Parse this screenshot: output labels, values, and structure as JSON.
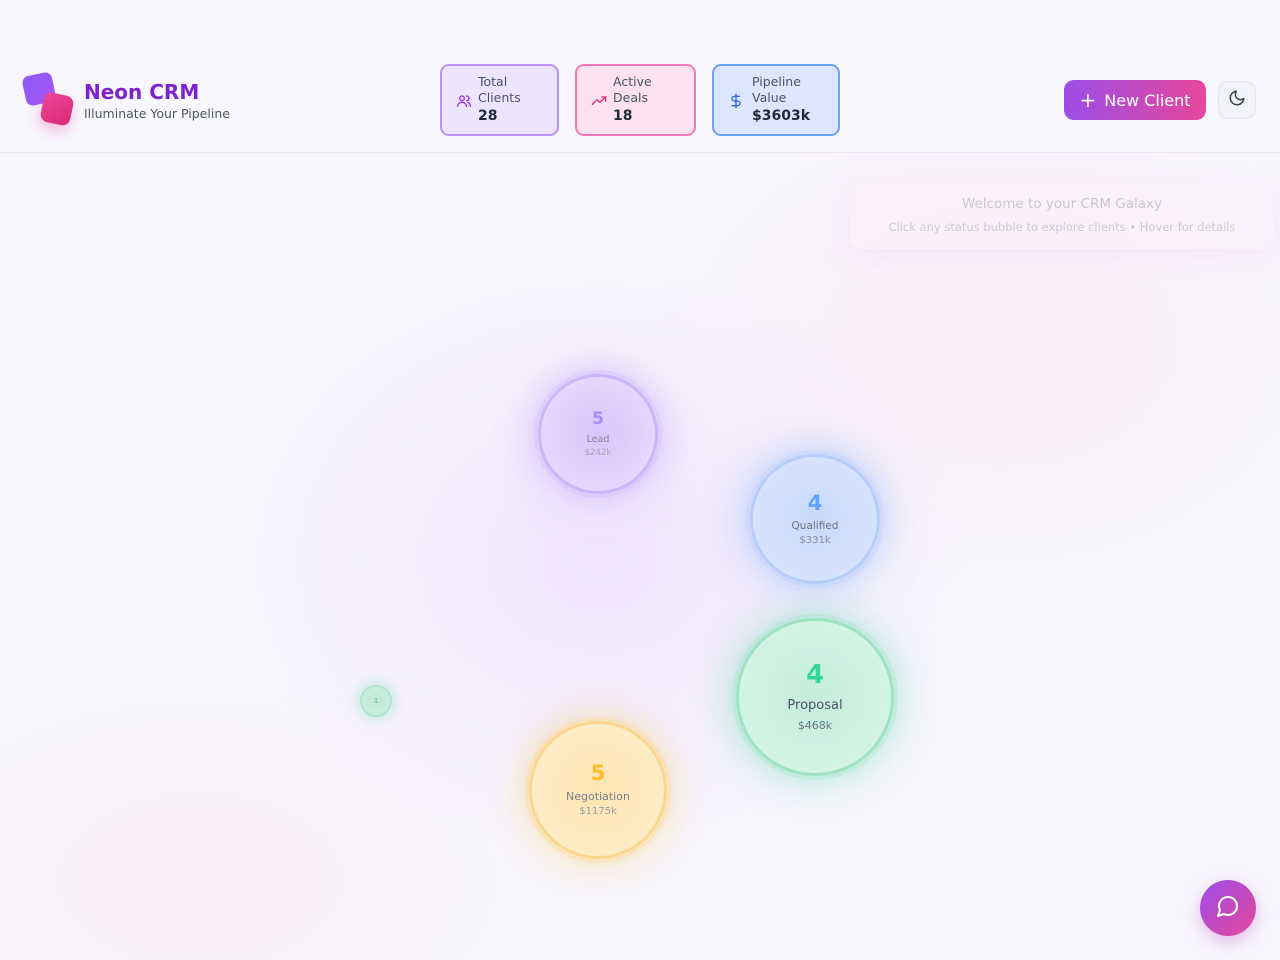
{
  "brand": {
    "title": "Neon CRM",
    "subtitle": "Illuminate Your Pipeline"
  },
  "stats": {
    "total_clients": {
      "label_line1": "Total",
      "label_line2": "Clients",
      "value": "28",
      "icon": "users-icon"
    },
    "active_deals": {
      "label_line1": "Active",
      "label_line2": "Deals",
      "value": "18",
      "icon": "trending-up-icon"
    },
    "pipeline_value": {
      "label_line1": "Pipeline",
      "label_line2": "Value",
      "value": "$3603k",
      "icon": "dollar-icon"
    }
  },
  "actions": {
    "new_client_label": "New Client",
    "theme_toggle_icon": "moon-icon",
    "chat_icon": "chat-bubble-icon"
  },
  "welcome": {
    "title": "Welcome to your CRM Galaxy",
    "subtitle": "Click any status bubble to explore clients • Hover for details"
  },
  "statuses": [
    {
      "name": "Lead",
      "count": "5",
      "amount": "$242k",
      "color": "#a78bfa"
    },
    {
      "name": "Qualified",
      "count": "4",
      "amount": "$331k",
      "color": "#60a5fa"
    },
    {
      "name": "Proposal",
      "count": "4",
      "amount": "$468k",
      "color": "#34d399"
    },
    {
      "name": "Negotiation",
      "count": "5",
      "amount": "$1175k",
      "color": "#fbbf24"
    }
  ],
  "mini_bubble": {
    "count": "1"
  },
  "colors": {
    "brand": "#7e22ce",
    "gradient_start": "#9b4de8",
    "gradient_end": "#e7479a"
  }
}
